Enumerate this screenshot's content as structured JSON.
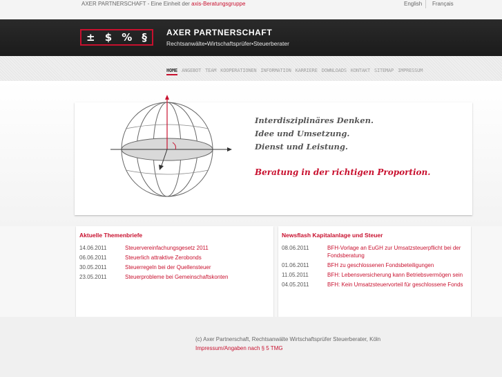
{
  "topbar": {
    "tagline_prefix": "AXER PARTNERSCHAFT - Eine Einheit der ",
    "tagline_link": "axis-Beratungsgruppe",
    "lang_en": "English",
    "lang_fr": "Français"
  },
  "header": {
    "logo_symbols": [
      "±",
      "$",
      "%",
      "§"
    ],
    "brand_name": "AXER PARTNERSCHAFT",
    "brand_sub": "Rechtsanwälte•Wirtschaftsprüfer•Steuerberater"
  },
  "nav": {
    "items": [
      "HOME",
      "ANGEBOT",
      "TEAM",
      "KOOPERATIONEN",
      "INFORMATION",
      "KARRIERE",
      "DOWNLOADS",
      "KONTAKT",
      "SITEMAP",
      "IMPRESSUM"
    ],
    "active": "HOME"
  },
  "hero": {
    "line1": "Interdisziplinäres Denken.",
    "line2": "Idee und Umsetzung.",
    "line3": "Dienst und Leistung.",
    "claim": "Beratung in der richtigen Proportion."
  },
  "themenbriefe": {
    "heading": "Aktuelle Themenbriefe",
    "items": [
      {
        "date": "14.06.2011",
        "title": "Steuervereinfachungsgesetz 2011"
      },
      {
        "date": "06.06.2011",
        "title": "Steuerlich attraktive Zerobonds"
      },
      {
        "date": "30.05.2011",
        "title": "Steuerregeln bei der Quellensteuer"
      },
      {
        "date": "23.05.2011",
        "title": "Steuerprobleme bei Gemeinschaftskonten"
      }
    ]
  },
  "newsflash": {
    "heading": "Newsflash Kapitalanlage und Steuer",
    "items": [
      {
        "date": "08.06.2011",
        "title": "BFH-Vorlage an EuGH zur Umsatzsteuerpflicht bei der Fondsberatung"
      },
      {
        "date": "01.06.2011",
        "title": "BFH zu geschlossenen Fondsbeteiligungen"
      },
      {
        "date": "11.05.2011",
        "title": "BFH: Lebensversicherung kann Betriebsvermögen sein"
      },
      {
        "date": "04.05.2011",
        "title": "BFH: Kein Umsatzsteuervorteil für geschlossene Fonds"
      }
    ]
  },
  "footer": {
    "copyright": "(c) Axer Partnerschaft, Rechtsanwälte Wirtschaftsprüfer Steuerberater, Köln",
    "imprint": "Impressum/Angaben nach § 5 TMG"
  },
  "colors": {
    "accent": "#c8102e",
    "header": "#1f1f1f"
  }
}
